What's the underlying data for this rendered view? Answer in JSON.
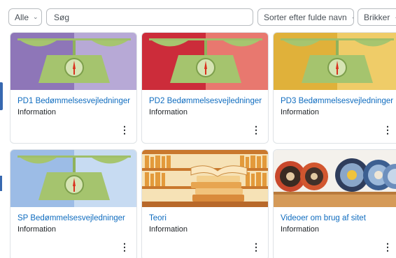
{
  "toolbar": {
    "filter_label": "Alle",
    "search_placeholder": "Søg",
    "sort_label": "Sorter efter fulde navn",
    "view_label": "Brikker"
  },
  "courses": [
    {
      "title": "PD1 Bedømmelsesvejledninger",
      "category": "Information",
      "image": "scale-icon",
      "colors": [
        "#8e76b8",
        "#b7a9d6"
      ]
    },
    {
      "title": "PD2 Bedømmelsesvejledninger",
      "category": "Information",
      "image": "scale-icon",
      "colors": [
        "#cc2c3a",
        "#e8786f"
      ]
    },
    {
      "title": "PD3 Bedømmelsesvejledninger",
      "category": "Information",
      "image": "scale-icon",
      "colors": [
        "#e0b13a",
        "#efcc68"
      ]
    },
    {
      "title": "SP Bedømmelsesvejledninger",
      "category": "Information",
      "image": "scale-icon",
      "colors": [
        "#9cbce6",
        "#c7dbf2"
      ]
    },
    {
      "title": "Teori",
      "category": "Information",
      "image": "books-icon",
      "colors": [
        "#f6e2b6",
        "#e9b86a"
      ]
    },
    {
      "title": "Videoer om brug af sitet",
      "category": "Information",
      "image": "film-reels-icon",
      "colors": [
        "#f4f1ec",
        "#e5dccf"
      ]
    }
  ],
  "menu_glyph": "⋮"
}
